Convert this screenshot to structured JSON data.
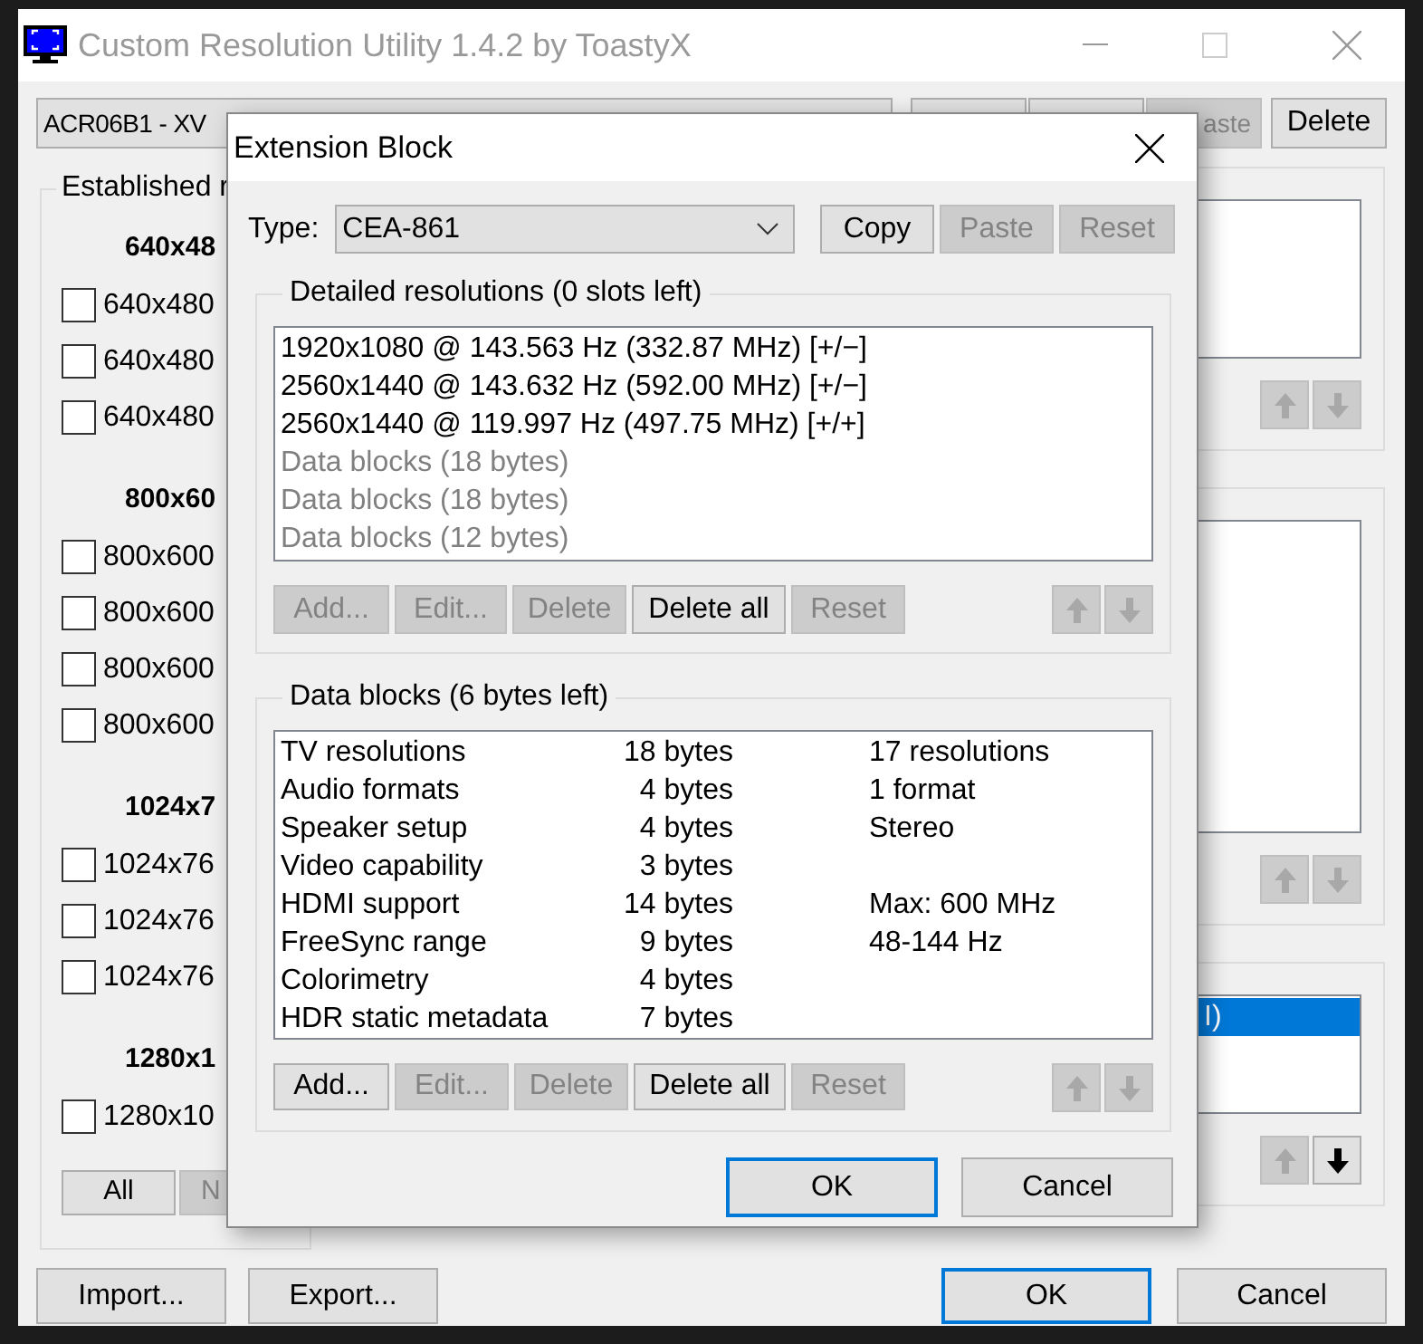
{
  "window": {
    "title": "Custom Resolution Utility 1.4.2 by ToastyX"
  },
  "monitor_select": {
    "value": "ACR06B1 - XV"
  },
  "top_buttons": [
    {
      "disabled": false
    },
    {
      "disabled": false
    },
    {
      "label": "aste",
      "disabled": true
    },
    {
      "label": "Delete",
      "disabled": false
    }
  ],
  "established": {
    "title": "Established r",
    "groups": [
      {
        "heading": "640x48",
        "items": [
          {
            "label": "640x480",
            "checked": false
          },
          {
            "label": "640x480",
            "checked": false
          },
          {
            "label": "640x480",
            "checked": false
          }
        ]
      },
      {
        "heading": "800x60",
        "items": [
          {
            "label": "800x600",
            "checked": false
          },
          {
            "label": "800x600",
            "checked": false
          },
          {
            "label": "800x600",
            "checked": false
          },
          {
            "label": "800x600",
            "checked": false
          }
        ]
      },
      {
        "heading": "1024x7",
        "items": [
          {
            "label": "1024x76",
            "checked": false
          },
          {
            "label": "1024x76",
            "checked": false
          },
          {
            "label": "1024x76",
            "checked": false
          }
        ]
      },
      {
        "heading": "1280x1",
        "items": [
          {
            "label": "1280x10",
            "checked": false
          }
        ]
      }
    ],
    "buttons": [
      {
        "label": "All",
        "disabled": false
      },
      {
        "label": "N",
        "disabled": true
      }
    ]
  },
  "right_panels": [
    {
      "arrows": [
        {
          "kind": "up",
          "disabled": true
        },
        {
          "kind": "down",
          "disabled": true
        }
      ]
    },
    {
      "arrows": [
        {
          "kind": "up",
          "disabled": true
        },
        {
          "kind": "down",
          "disabled": true
        }
      ]
    },
    {
      "items": [
        {
          "label": "I)",
          "selected": true
        }
      ],
      "arrows": [
        {
          "kind": "up",
          "disabled": true
        },
        {
          "kind": "down",
          "disabled": false
        }
      ]
    }
  ],
  "bottom_buttons": [
    {
      "label": "Import...",
      "default": false
    },
    {
      "label": "Export...",
      "default": false
    },
    {
      "label": "OK",
      "default": true
    },
    {
      "label": "Cancel",
      "default": false
    }
  ],
  "dialog": {
    "title": "Extension Block",
    "type_label": "Type:",
    "type_value": "CEA-861",
    "type_buttons": [
      {
        "label": "Copy",
        "disabled": false
      },
      {
        "label": "Paste",
        "disabled": true
      },
      {
        "label": "Reset",
        "disabled": true
      }
    ],
    "detailed": {
      "title": "Detailed resolutions (0 slots left)",
      "items": [
        {
          "text": "1920x1080 @ 143.563 Hz (332.87 MHz) [+/−]",
          "kind": "timing"
        },
        {
          "text": "2560x1440 @ 143.632 Hz (592.00 MHz) [+/−]",
          "kind": "timing"
        },
        {
          "text": "2560x1440 @ 119.997 Hz (497.75 MHz) [+/+]",
          "kind": "timing"
        },
        {
          "text": "Data blocks (18 bytes)",
          "kind": "data_block"
        },
        {
          "text": "Data blocks (18 bytes)",
          "kind": "data_block"
        },
        {
          "text": "Data blocks (12 bytes)",
          "kind": "data_block"
        }
      ],
      "buttons": [
        {
          "label": "Add...",
          "disabled": true
        },
        {
          "label": "Edit...",
          "disabled": true
        },
        {
          "label": "Delete",
          "disabled": true
        },
        {
          "label": "Delete all",
          "disabled": false
        },
        {
          "label": "Reset",
          "disabled": true
        }
      ],
      "arrows": [
        {
          "kind": "up",
          "disabled": true
        },
        {
          "kind": "down",
          "disabled": true
        }
      ]
    },
    "data_blocks": {
      "title": "Data blocks (6 bytes left)",
      "rows": [
        {
          "name": "TV resolutions",
          "size": "18 bytes",
          "info": "17 resolutions"
        },
        {
          "name": "Audio formats",
          "size": "4 bytes",
          "info": "1 format"
        },
        {
          "name": "Speaker setup",
          "size": "4 bytes",
          "info": "Stereo"
        },
        {
          "name": "Video capability",
          "size": "3 bytes"
        },
        {
          "name": "HDMI support",
          "size": "14 bytes",
          "info": "Max: 600 MHz"
        },
        {
          "name": "FreeSync range",
          "size": "9 bytes",
          "info": "48-144 Hz"
        },
        {
          "name": "Colorimetry",
          "size": "4 bytes"
        },
        {
          "name": "HDR static metadata",
          "size": "7 bytes"
        }
      ],
      "buttons": [
        {
          "label": "Add...",
          "disabled": false
        },
        {
          "label": "Edit...",
          "disabled": true
        },
        {
          "label": "Delete",
          "disabled": true
        },
        {
          "label": "Delete all",
          "disabled": false
        },
        {
          "label": "Reset",
          "disabled": true
        }
      ],
      "arrows": [
        {
          "kind": "up",
          "disabled": true
        },
        {
          "kind": "down",
          "disabled": true
        }
      ]
    },
    "buttons": [
      {
        "label": "OK",
        "default": true
      },
      {
        "label": "Cancel",
        "default": false
      }
    ]
  }
}
